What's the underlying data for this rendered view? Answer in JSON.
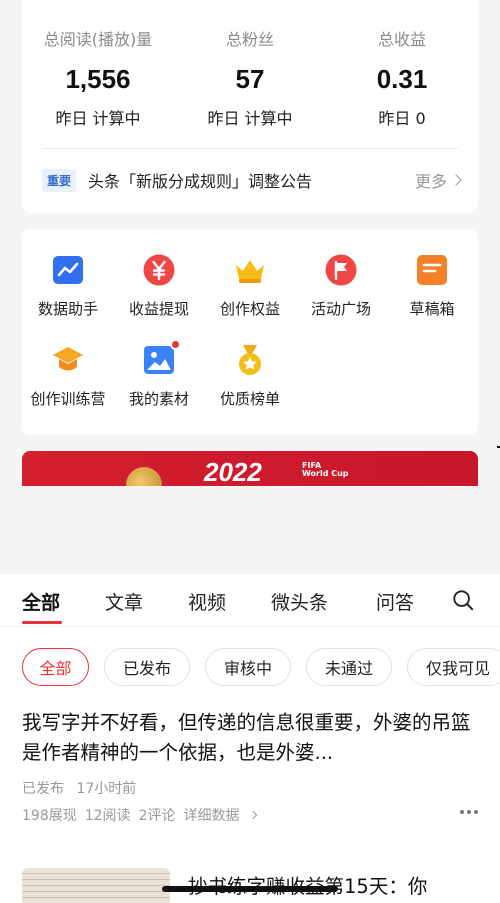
{
  "stats": [
    {
      "label": "总阅读(播放)量",
      "value": "1,556",
      "sub": "昨日 计算中"
    },
    {
      "label": "总粉丝",
      "value": "57",
      "sub": "昨日 计算中"
    },
    {
      "label": "总收益",
      "value": "0.31",
      "sub": "昨日 0"
    }
  ],
  "notice": {
    "badge": "重要",
    "text": "头条「新版分成规则」调整公告",
    "more": "更多"
  },
  "tools": [
    {
      "label": "数据助手",
      "icon": "chart-icon"
    },
    {
      "label": "收益提现",
      "icon": "yen-icon"
    },
    {
      "label": "创作权益",
      "icon": "crown-icon"
    },
    {
      "label": "活动广场",
      "icon": "flag-icon"
    },
    {
      "label": "草稿箱",
      "icon": "draft-icon"
    },
    {
      "label": "创作训练营",
      "icon": "graduation-cap-icon"
    },
    {
      "label": "我的素材",
      "icon": "image-icon"
    },
    {
      "label": "优质榜单",
      "icon": "medal-icon"
    }
  ],
  "banner": {
    "text": "2022",
    "sub_line1": "FIFA",
    "sub_line2": "World Cup"
  },
  "colors": {
    "accent": "#e8323c",
    "badge_blue": "#3a6fd0"
  },
  "tabs": [
    "全部",
    "文章",
    "视频",
    "微头条",
    "问答"
  ],
  "chips": [
    "全部",
    "已发布",
    "审核中",
    "未通过",
    "仅我可见"
  ],
  "article": {
    "title": "我写字并不好看，但传递的信息很重要，外婆的吊篮是作者精神的一个依据，也是外婆...",
    "status": "已发布",
    "time": "17小时前",
    "views": "198展现",
    "reads": "12阅读",
    "comments": "2评论",
    "details": "详细数据"
  },
  "article2": {
    "title": "抄书练字赚收益第15天：你"
  }
}
